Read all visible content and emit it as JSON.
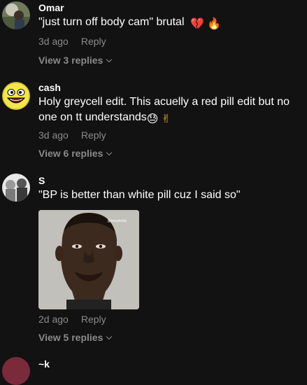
{
  "comments": [
    {
      "username": "Omar",
      "text": "\"just turn off body cam\" brutal",
      "emojis": [
        "💔",
        "🔥"
      ],
      "time": "3d ago",
      "reply_label": "Reply",
      "view_replies": "View 3 replies"
    },
    {
      "username": "cash",
      "text_line1": "Holy greycell edit. This acuelly a red pill edit but no",
      "text_line2": "one on tt understands",
      "emojis": [
        "😓",
        "✌"
      ],
      "time": "3d ago",
      "reply_label": "Reply",
      "view_replies": "View 6 replies"
    },
    {
      "username": "S",
      "text": "\"BP is better than white pill cuz I said so\"",
      "image_watermark": "@trezphotia",
      "time": "2d ago",
      "reply_label": "Reply",
      "view_replies": "View 5 replies"
    }
  ],
  "partial_next_username": "~k"
}
